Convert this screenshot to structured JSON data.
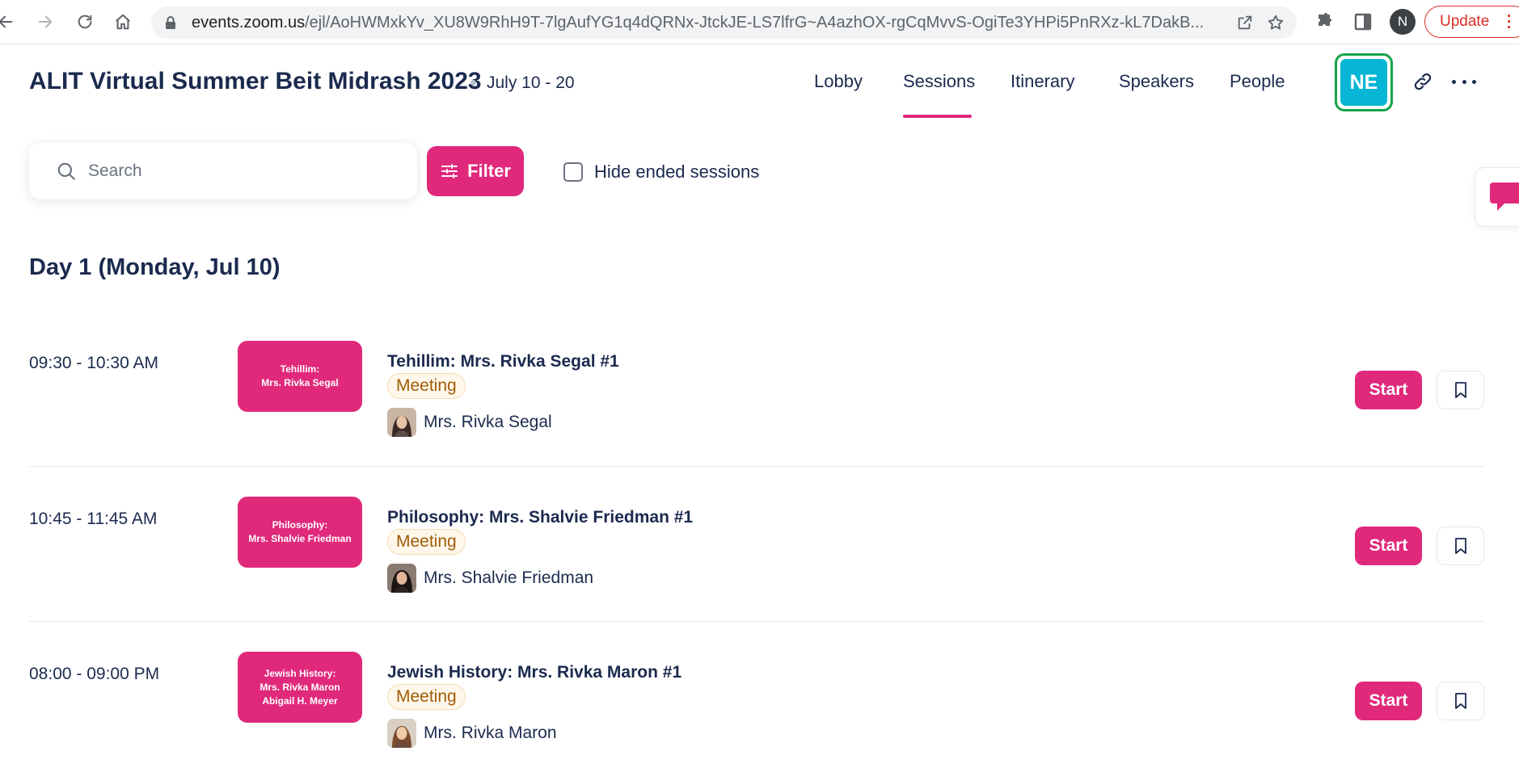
{
  "browser": {
    "url_host": "events.zoom.us",
    "url_path": "/ejl/AoHWMxkYv_XU8W9RhH9T-7lgAufYG1q4dQRNx-JtckJE-LS7lfrG~A4azhOX-rgCqMvvS-OgiTe3YHPi5PnRXz-kL7DakB...",
    "profile_initial": "N",
    "update_label": "Update"
  },
  "event": {
    "title": "ALIT Virtual Summer Beit Midrash 2023",
    "dates": "July 10 - 20"
  },
  "nav": {
    "tabs": [
      {
        "label": "Lobby",
        "active": false
      },
      {
        "label": "Sessions",
        "active": true
      },
      {
        "label": "Itinerary",
        "active": false
      },
      {
        "label": "Speakers",
        "active": false
      },
      {
        "label": "People",
        "active": false
      }
    ],
    "user_initials": "NE"
  },
  "toolbar": {
    "search_placeholder": "Search",
    "filter_label": "Filter",
    "hide_ended_label": "Hide ended sessions",
    "hide_ended_checked": false
  },
  "day": {
    "heading": "Day 1  (Monday, Jul 10)"
  },
  "sessions": [
    {
      "time": "09:30 - 10:30 AM",
      "thumb_lines": [
        "Tehillim:",
        "Mrs. Rivka Segal",
        ""
      ],
      "title": "Tehillim: Mrs. Rivka Segal #1",
      "type": "Meeting",
      "speaker": "Mrs. Rivka Segal",
      "start_label": "Start"
    },
    {
      "time": "10:45 - 11:45 AM",
      "thumb_lines": [
        "Philosophy:",
        "Mrs. Shalvie Friedman",
        ""
      ],
      "title": "Philosophy: Mrs. Shalvie Friedman #1",
      "type": "Meeting",
      "speaker": "Mrs. Shalvie Friedman",
      "start_label": "Start"
    },
    {
      "time": "08:00 - 09:00 PM",
      "thumb_lines": [
        "Jewish History:",
        "Mrs. Rivka Maron",
        "Abigail H. Meyer"
      ],
      "title": "Jewish History: Mrs. Rivka Maron #1",
      "type": "Meeting",
      "speaker": "Mrs. Rivka Maron",
      "start_label": "Start"
    }
  ],
  "colors": {
    "accent": "#e0297b",
    "text": "#1b2a4e",
    "avatar_bg": "#06b6d4",
    "avatar_border": "#16a34a",
    "badge_text": "#a15c07"
  },
  "icons": {
    "back": "back-arrow-icon",
    "forward": "forward-arrow-icon",
    "reload": "reload-icon",
    "home": "home-icon",
    "lock": "lock-icon",
    "share": "share-icon",
    "star": "star-icon",
    "extensions": "puzzle-icon",
    "side_panel": "side-panel-icon",
    "link": "link-icon",
    "more": "more-dots-icon",
    "search": "search-icon",
    "filter": "sliders-icon",
    "chat": "chat-icon",
    "bookmark": "bookmark-icon"
  }
}
